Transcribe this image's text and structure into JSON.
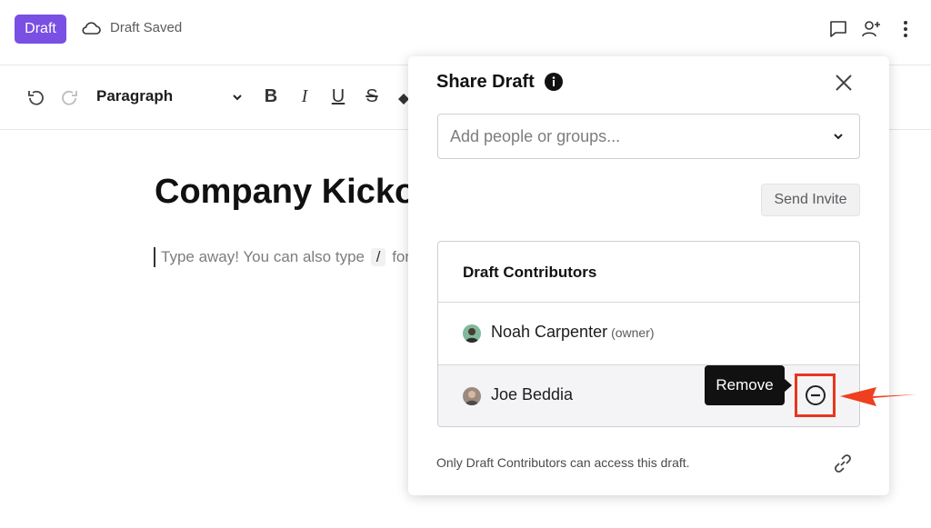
{
  "header": {
    "status_badge": "Draft",
    "save_status": "Draft Saved",
    "icons": [
      "comment-icon",
      "add-user-icon",
      "more-vertical-icon"
    ],
    "badge_color": "#7a4fe3"
  },
  "toolbar": {
    "block_type": "Paragraph",
    "icons": [
      "undo-icon",
      "redo-icon",
      "chevron-down-icon",
      "bold-icon",
      "italic-icon",
      "underline-icon",
      "strikethrough-icon",
      "fill-color-icon"
    ]
  },
  "editor": {
    "title": "Company Kickoff",
    "placeholder_prefix": "Type away! You can also type",
    "slash": "/",
    "placeholder_suffix": "for commands"
  },
  "share": {
    "title": "Share Draft",
    "input_placeholder": "Add people or groups...",
    "send_button": "Send Invite",
    "contributors_header": "Draft Contributors",
    "contributors": [
      {
        "name": "Noah Carpenter",
        "role": "(owner)"
      },
      {
        "name": "Joe Beddia",
        "role": ""
      }
    ],
    "tooltip": "Remove",
    "footer": "Only Draft Contributors can access this draft.",
    "highlight_color": "#e8361f"
  }
}
